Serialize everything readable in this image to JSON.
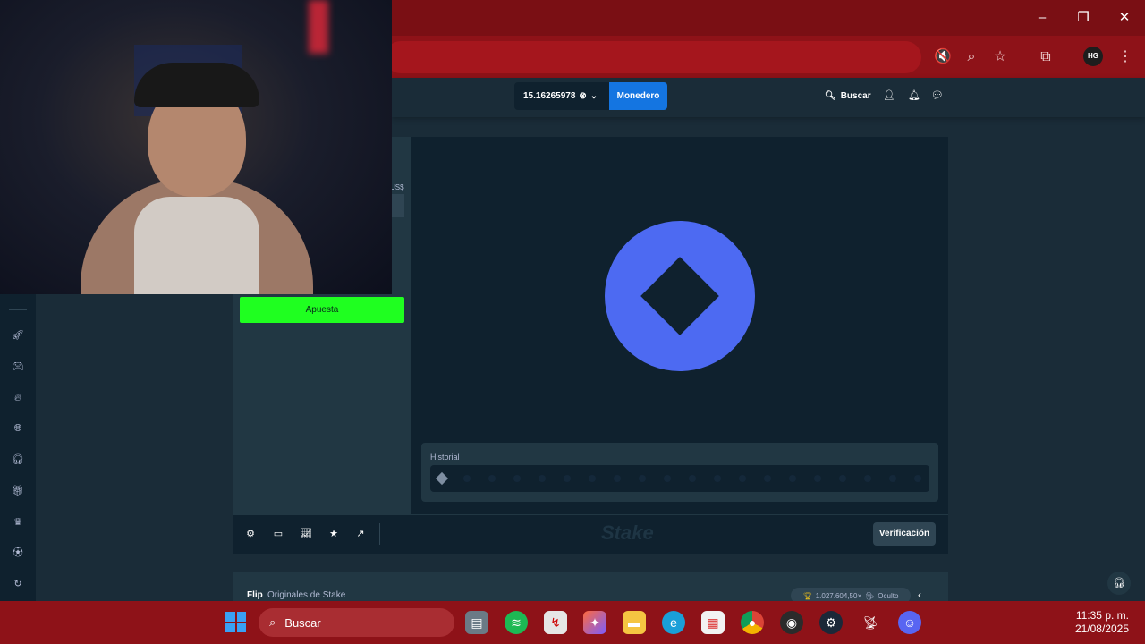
{
  "browser": {
    "window_controls": {
      "minimize": "–",
      "restore": "❐",
      "close": "✕"
    },
    "toolbar_icons": [
      "mute-icon",
      "zoom-icon",
      "bookmark-star-icon",
      "extensions-icon"
    ],
    "profile_initials": "HG"
  },
  "header": {
    "balance": "15.16265978",
    "wallet_label": "Monedero",
    "search_label": "Buscar"
  },
  "game": {
    "currency_label": "US$",
    "bet_button_label": "Apuesta",
    "history_label": "Historial",
    "verify_label": "Verificación",
    "brand_mark": "Stake",
    "title": "Flip",
    "subtitle": "Originales de Stake",
    "max_win": "1.027.604,50×",
    "visibility_label": "Oculto",
    "colors": {
      "coin": "#4d6af2",
      "bet_button": "#1fff20",
      "wallet": "#1475e1"
    }
  },
  "sidebar_icons": [
    "rocket-icon",
    "controller-icon",
    "fire-icon",
    "globe-icon",
    "headset-icon",
    "gift-icon",
    "crown-icon",
    "ball-icon",
    "support-icon"
  ],
  "taskbar": {
    "search_placeholder": "Buscar",
    "apps": [
      "file-explorer-icon",
      "spotify-icon",
      "app-icon",
      "copilot-icon",
      "folder-icon",
      "edge-icon",
      "store-icon",
      "chrome-icon",
      "obs-icon",
      "steam-icon",
      "satellite-icon",
      "discord-icon"
    ],
    "time": "11:35 p. m.",
    "date": "21/08/2025"
  }
}
